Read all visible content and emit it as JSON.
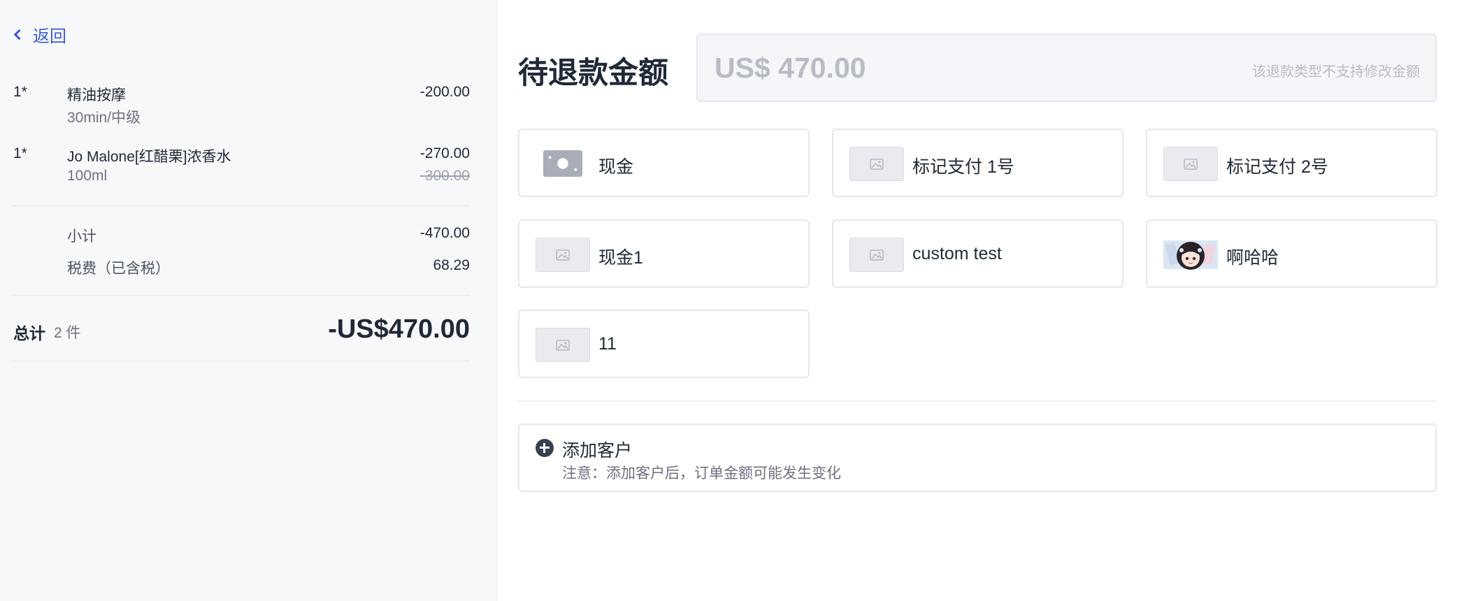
{
  "nav": {
    "back_label": "返回"
  },
  "order": {
    "items": [
      {
        "qty": "1*",
        "name": "精油按摩",
        "sub": "30min/中级",
        "price": "-200.00",
        "original_price": ""
      },
      {
        "qty": "1*",
        "name": "Jo Malone[红醋栗]浓香水",
        "sub": "100ml",
        "price": "-270.00",
        "original_price": "-300.00"
      }
    ],
    "subtotal_label": "小计",
    "subtotal_value": "-470.00",
    "tax_label": "税费（已含税）",
    "tax_value": "68.29",
    "total_label": "总计",
    "total_count": "2 件",
    "total_value": "-US$470.00"
  },
  "refund": {
    "title": "待退款金额",
    "amount": "US$ 470.00",
    "hint": "该退款类型不支持修改金额"
  },
  "payment_methods": [
    {
      "label": "现金",
      "icon": "cash-icon"
    },
    {
      "label": "标记支付 1号",
      "icon": "image-placeholder-icon"
    },
    {
      "label": "标记支付 2号",
      "icon": "image-placeholder-icon"
    },
    {
      "label": "现金1",
      "icon": "image-placeholder-icon"
    },
    {
      "label": "custom test",
      "icon": "image-placeholder-icon"
    },
    {
      "label": "啊哈哈",
      "icon": "avatar-image-icon"
    },
    {
      "label": "11",
      "icon": "image-placeholder-icon"
    }
  ],
  "customer": {
    "add_label": "添加客户",
    "note": "注意：添加客户后，订单金额可能发生变化"
  }
}
